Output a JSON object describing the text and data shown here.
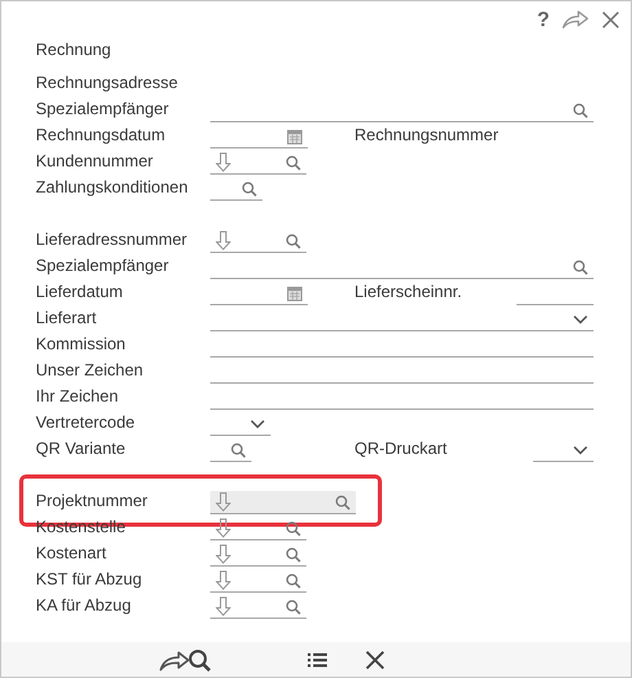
{
  "header": {
    "help": "?",
    "actions": [
      {
        "kind": "forward"
      },
      {
        "kind": "close"
      }
    ]
  },
  "title": "Rechnung",
  "sections": [
    {
      "rows": [
        {
          "label": "Rechnungsadresse"
        },
        {
          "label": "Spezialempfänger",
          "field": {
            "kind": "search-wide"
          }
        },
        {
          "label": "Rechnungsdatum",
          "field": {
            "kind": "date"
          },
          "second_label": "Rechnungsnummer"
        },
        {
          "label": "Kundennummer",
          "field": {
            "kind": "lookup"
          }
        },
        {
          "label": "Zahlungskonditionen",
          "field": {
            "kind": "search"
          }
        }
      ]
    },
    {
      "rows": [
        {
          "label": "Lieferadressnummer",
          "field": {
            "kind": "lookup"
          }
        },
        {
          "label": "Spezialempfänger",
          "field": {
            "kind": "search-wide"
          }
        },
        {
          "label": "Lieferdatum",
          "field": {
            "kind": "date"
          },
          "second_label": "Lieferscheinnr.",
          "second_field": {
            "kind": "text"
          }
        },
        {
          "label": "Lieferart",
          "field": {
            "kind": "select-wide"
          }
        },
        {
          "label": "Kommission",
          "field": {
            "kind": "text-wide"
          }
        },
        {
          "label": "Unser Zeichen",
          "field": {
            "kind": "text-wide"
          }
        },
        {
          "label": "Ihr Zeichen",
          "field": {
            "kind": "text-wide"
          }
        },
        {
          "label": "Vertretercode",
          "field": {
            "kind": "select"
          }
        },
        {
          "label": "QR Variante",
          "field": {
            "kind": "search-small"
          },
          "second_label": "QR-Druckart",
          "second_field": {
            "kind": "select"
          }
        }
      ]
    },
    {
      "rows": [
        {
          "label": "Projektnummer",
          "field": {
            "kind": "lookup",
            "selected": true
          },
          "highlighted": true
        },
        {
          "label": "Kostenstelle",
          "field": {
            "kind": "lookup",
            "selected": false
          },
          "highlighted": false
        },
        {
          "label": "Kostenart",
          "field": {
            "kind": "lookup",
            "selected": false
          },
          "highlighted": false
        },
        {
          "label": "KST für Abzug",
          "field": {
            "kind": "lookup",
            "selected": false
          },
          "highlighted": false
        },
        {
          "label": "KA für Abzug",
          "field": {
            "kind": "lookup",
            "selected": false
          },
          "highlighted": false
        }
      ]
    }
  ],
  "toolbar": [
    {
      "kind": "forward-search"
    },
    {
      "kind": "list"
    },
    {
      "kind": "close"
    }
  ]
}
